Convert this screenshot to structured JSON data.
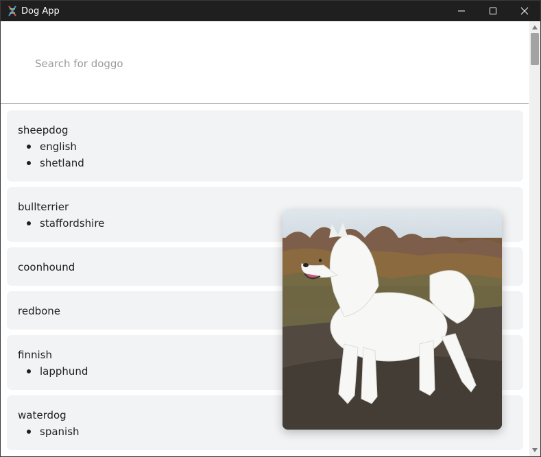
{
  "window": {
    "title": "Dog App",
    "controls": [
      "minimize-icon",
      "maximize-icon",
      "close-icon"
    ]
  },
  "search": {
    "placeholder": "Search for doggo",
    "value": ""
  },
  "breeds": [
    {
      "name": "sheepdog",
      "sub": [
        "english",
        "shetland"
      ]
    },
    {
      "name": "bullterrier",
      "sub": [
        "staffordshire"
      ]
    },
    {
      "name": "coonhound",
      "sub": []
    },
    {
      "name": "redbone",
      "sub": []
    },
    {
      "name": "finnish",
      "sub": [
        "lapphund"
      ]
    },
    {
      "name": "waterdog",
      "sub": [
        "spanish"
      ]
    }
  ],
  "popup": {
    "image": "white-samoyed-dog-photo"
  },
  "colors": {
    "titlebar": "#1f1f1f",
    "card_background": "#f2f3f5",
    "placeholder_text": "#9a9a9a",
    "scroll_thumb": "#a3a3a3"
  }
}
